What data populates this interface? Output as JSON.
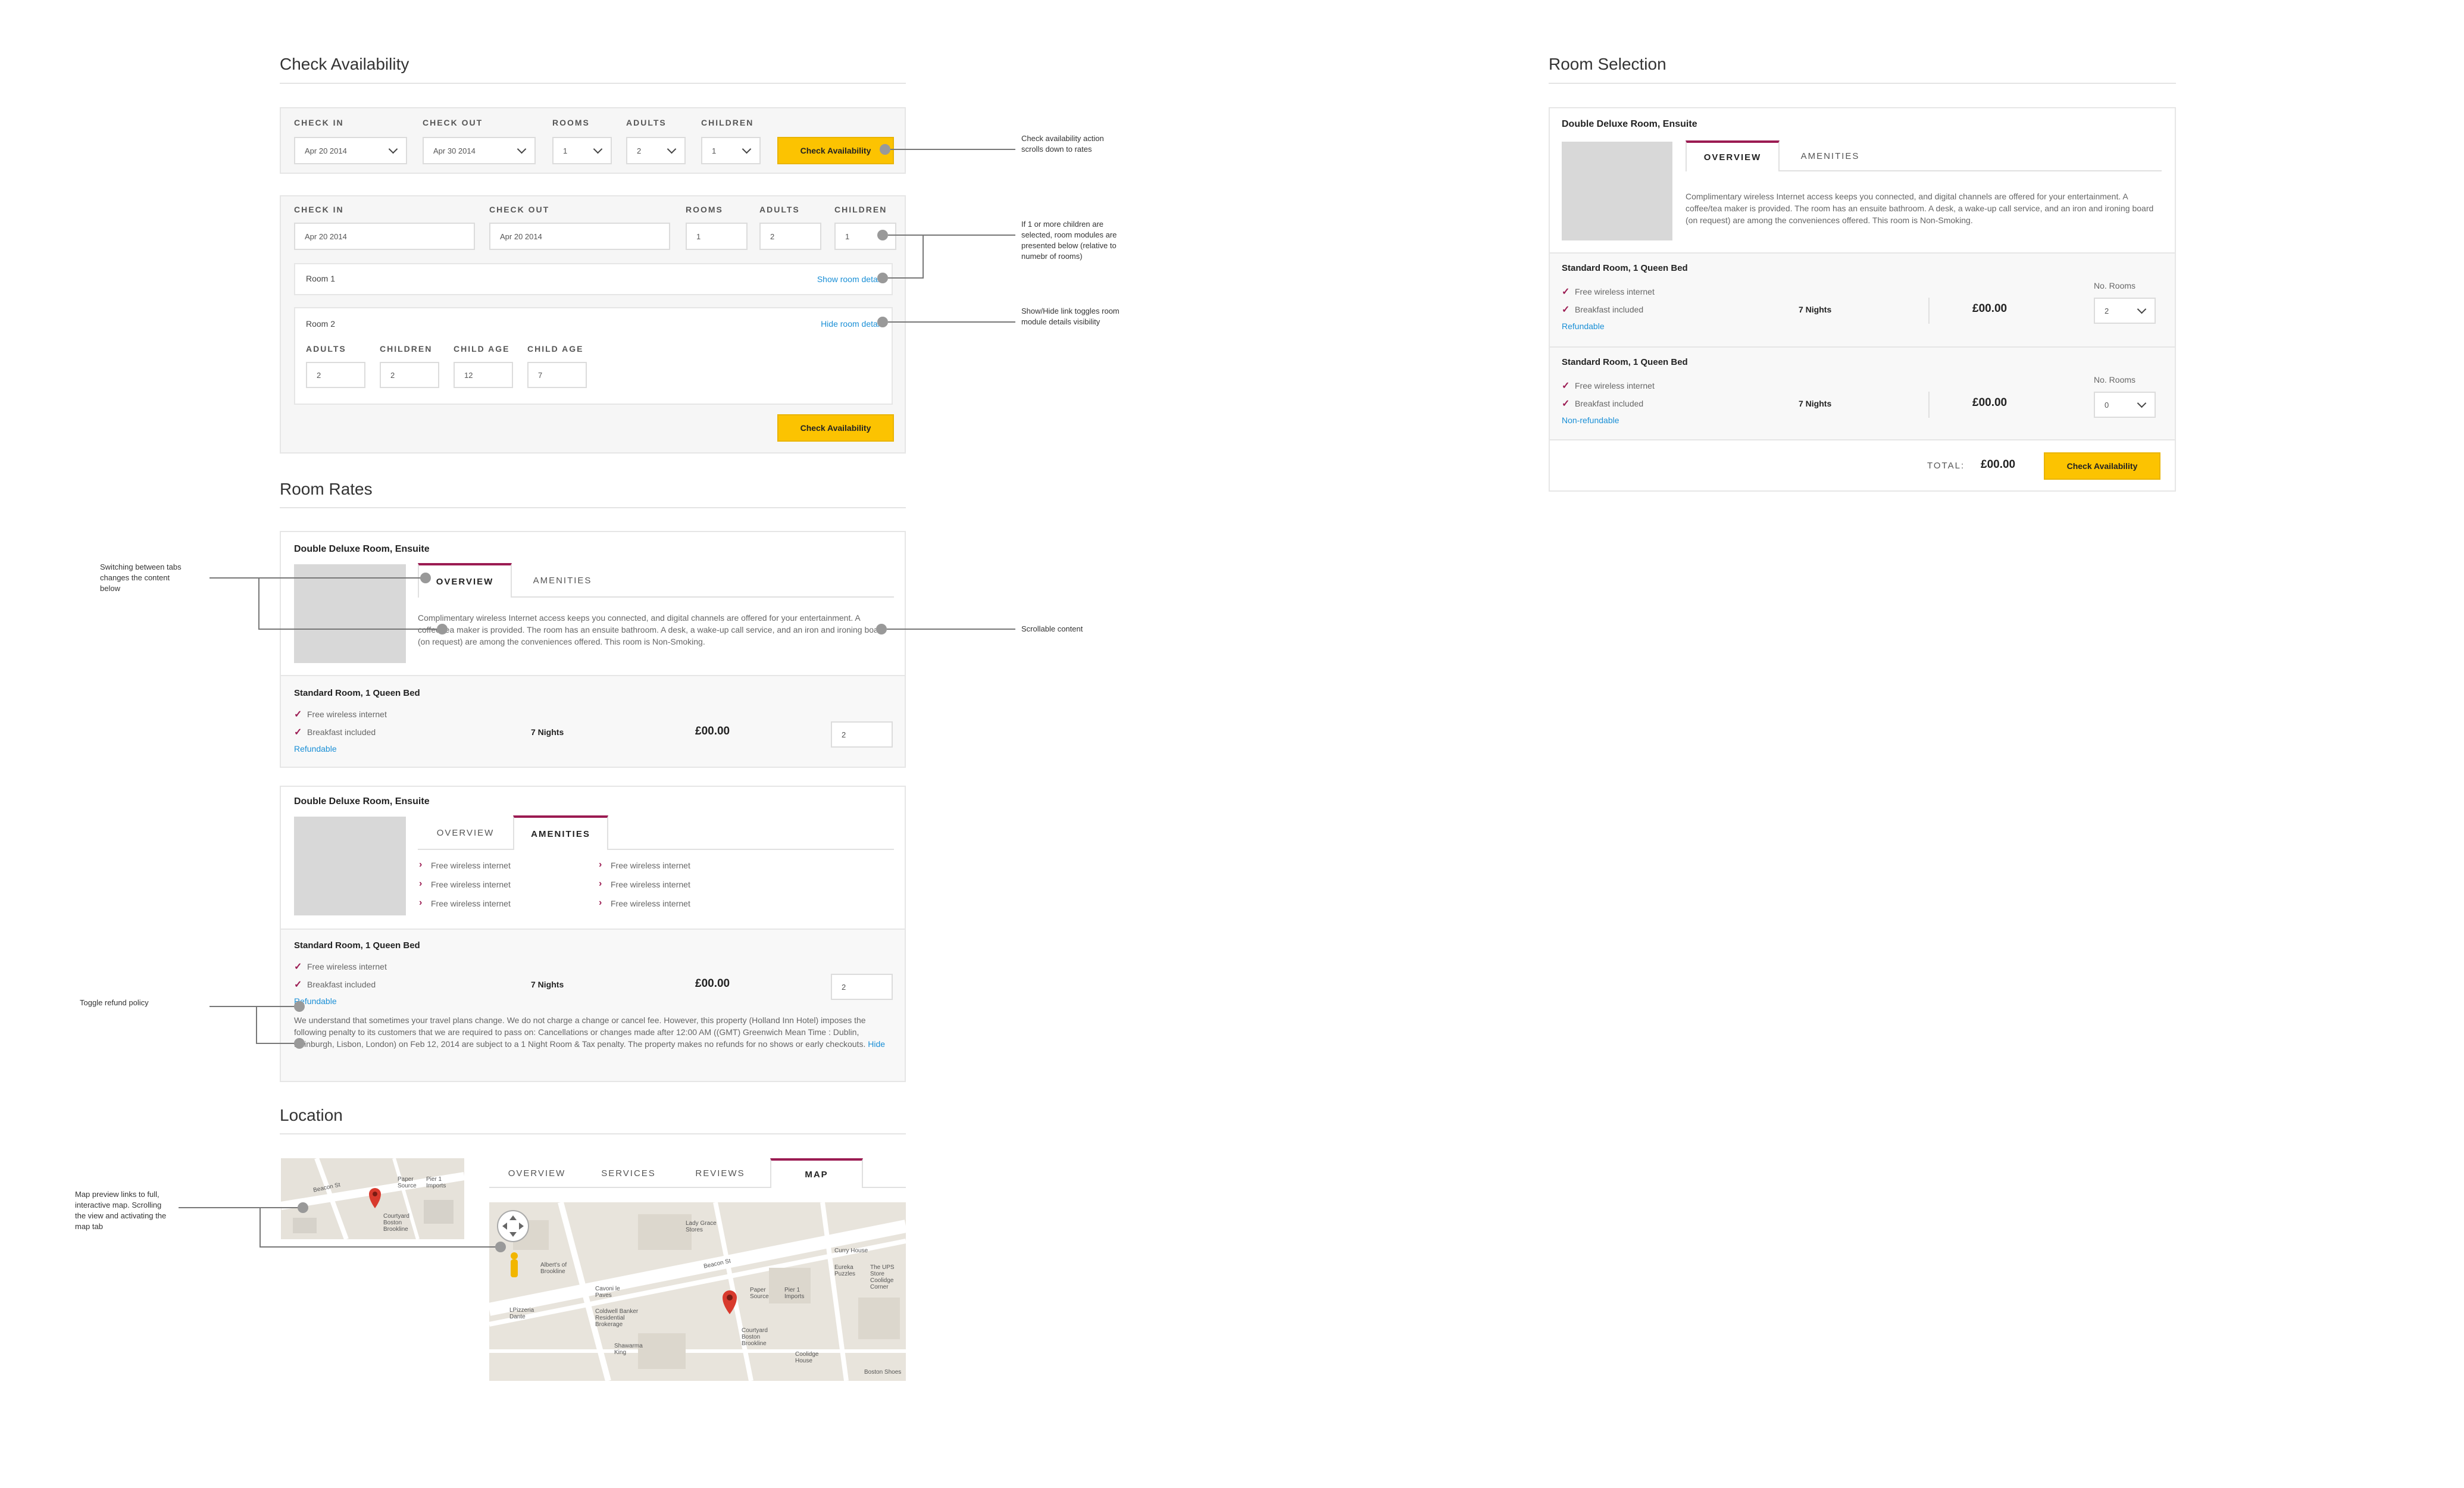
{
  "check_availability": {
    "title": "Check Availability",
    "labels": {
      "check_in": "CHECK IN",
      "check_out": "CHECK OUT",
      "rooms": "ROOMS",
      "adults": "ADULTS",
      "children": "CHILDREN",
      "child_age": "CHILD AGE"
    },
    "form1": {
      "check_in": "Apr 20 2014",
      "check_out": "Apr 30 2014",
      "rooms": "1",
      "adults": "2",
      "children": "1"
    },
    "form2": {
      "check_in": "Apr 20 2014",
      "check_out": "Apr 20 2014",
      "rooms": "1",
      "adults": "2",
      "children": "1"
    },
    "room1": {
      "label": "Room 1",
      "toggle": "Show room details"
    },
    "room2": {
      "label": "Room 2",
      "toggle": "Hide room details",
      "adults": "2",
      "children": "2",
      "child_age_1": "12",
      "child_age_2": "7"
    },
    "button": "Check Availability"
  },
  "room_rates": {
    "title": "Room Rates",
    "card_title": "Double Deluxe Room, Ensuite",
    "tab_overview": "OVERVIEW",
    "tab_amenities": "AMENITIES",
    "description": "Complimentary wireless Internet access keeps you connected, and digital channels are offered for your entertainment. A coffee/tea maker is provided. The room has an ensuite bathroom. A desk, a wake-up call service, and an iron and ironing board (on request) are among the conveniences offered. This room is Non-Smoking.",
    "rate_title": "Standard Room, 1 Queen Bed",
    "feature_1": "Free wireless internet",
    "feature_2": "Breakfast included",
    "refundable": "Refundable",
    "nights": "7 Nights",
    "price": "£00.00",
    "qty": "2",
    "amenity": "Free wireless internet",
    "policy": "We understand that sometimes your travel plans change. We do not charge a change or cancel fee. However, this property (Holland Inn Hotel) imposes the following penalty to its customers that we are required to pass on: Cancellations or changes made after 12:00 AM ((GMT) Greenwich Mean Time : Dublin, Edinburgh, Lisbon, London) on Feb 12, 2014 are subject to a 1 Night Room & Tax penalty. The property makes no refunds for no shows or early checkouts.",
    "hide": "Hide"
  },
  "location": {
    "title": "Location",
    "tabs": [
      "OVERVIEW",
      "SERVICES",
      "REVIEWS",
      "MAP"
    ],
    "map_labels": [
      "Paper Source",
      "Pier 1 Imports",
      "Courtyard Boston Brookline",
      "Lady Grace Stores",
      "Albert's of Brookline",
      "Cavoni le Paves",
      "Curry House",
      "Eureka Puzzles",
      "The UPS Store Coolidge Corner",
      "Coldwell Banker Residential Brokerage",
      "Shawarma King",
      "Coolidge House",
      "Boston Shoes",
      "LPizzeria Dante",
      "Beacon St"
    ]
  },
  "room_selection": {
    "title": "Room Selection",
    "card_title": "Double Deluxe Room, Ensuite",
    "rate_1": {
      "title": "Standard Room, 1 Queen Bed",
      "policy": "Refundable",
      "rooms": "2"
    },
    "rate_2": {
      "title": "Standard Room, 1 Queen Bed",
      "policy": "Non-refundable",
      "rooms": "0"
    },
    "no_rooms": "No. Rooms",
    "total_label": "TOTAL:",
    "total": "£00.00",
    "button": "Check Availability"
  },
  "annotations": {
    "a1": "Check availability action scrolls down to rates",
    "a2": "If 1 or more children are selected, room modules are presented below (relative to numebr of rooms)",
    "a3": "Show/Hide link toggles room module details visibility",
    "a4": "Switching between tabs changes the content below",
    "a5": "Scrollable content",
    "a6": "Toggle refund policy",
    "a7": "Map preview links to full, interactive map. Scrolling the view and activating the map tab"
  }
}
